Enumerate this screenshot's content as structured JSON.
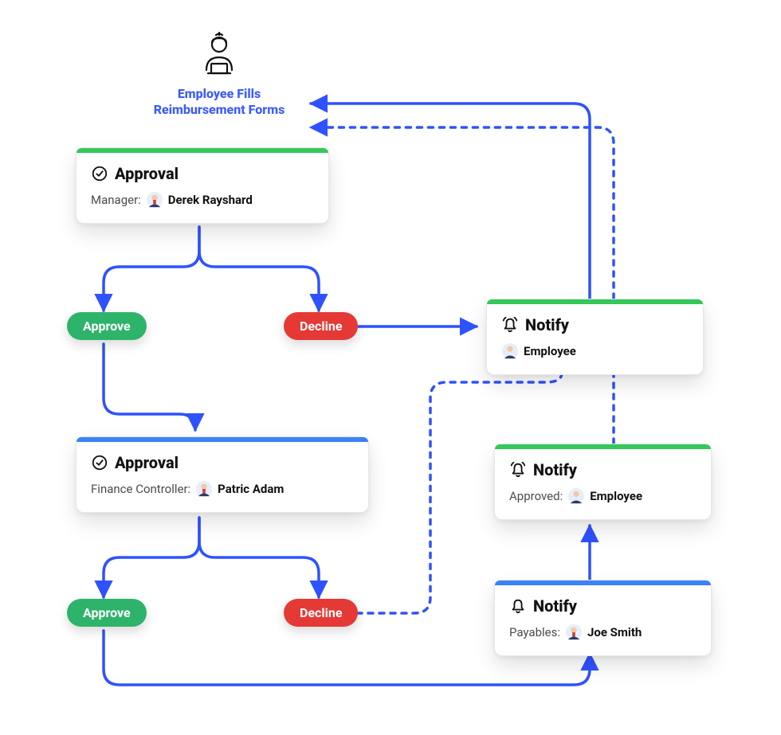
{
  "colors": {
    "connector": "#2f52ff",
    "green": "#34c759",
    "blue": "#3b82f6",
    "pillGreen": "#2eb36a",
    "pillRed": "#e53935"
  },
  "start": {
    "line1": "Employee Fills",
    "line2": "Reimbursement Forms"
  },
  "nodes": {
    "approval1": {
      "title": "Approval",
      "roleLabel": "Manager:",
      "person": "Derek Rayshard",
      "bar": "green"
    },
    "approval2": {
      "title": "Approval",
      "roleLabel": "Finance Controller:",
      "person": "Patric Adam",
      "bar": "blue"
    },
    "notify1": {
      "title": "Notify",
      "roleLabel": "",
      "person": "Employee",
      "bar": "green"
    },
    "notify2": {
      "title": "Notify",
      "roleLabel": "Approved:",
      "person": "Employee",
      "bar": "green"
    },
    "notify3": {
      "title": "Notify",
      "roleLabel": "Payables:",
      "person": "Joe Smith",
      "bar": "blue"
    }
  },
  "pills": {
    "approve1": "Approve",
    "decline1": "Decline",
    "approve2": "Approve",
    "decline2": "Decline"
  }
}
